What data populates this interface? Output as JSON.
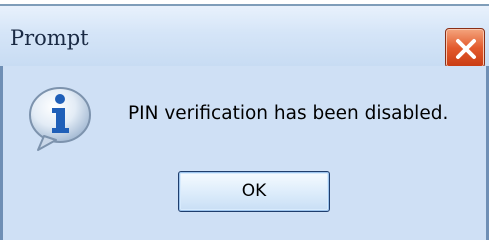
{
  "window": {
    "title": "Prompt",
    "close_icon": "close-icon",
    "colors": {
      "body": "#cfe0f5",
      "titlebar": "#d5e5f8",
      "close_button": "#e35a2d",
      "icon_blue": "#1f5fb8"
    }
  },
  "dialog": {
    "icon": "info-icon",
    "message": "PIN verification has been disabled.",
    "ok_label": "OK"
  }
}
